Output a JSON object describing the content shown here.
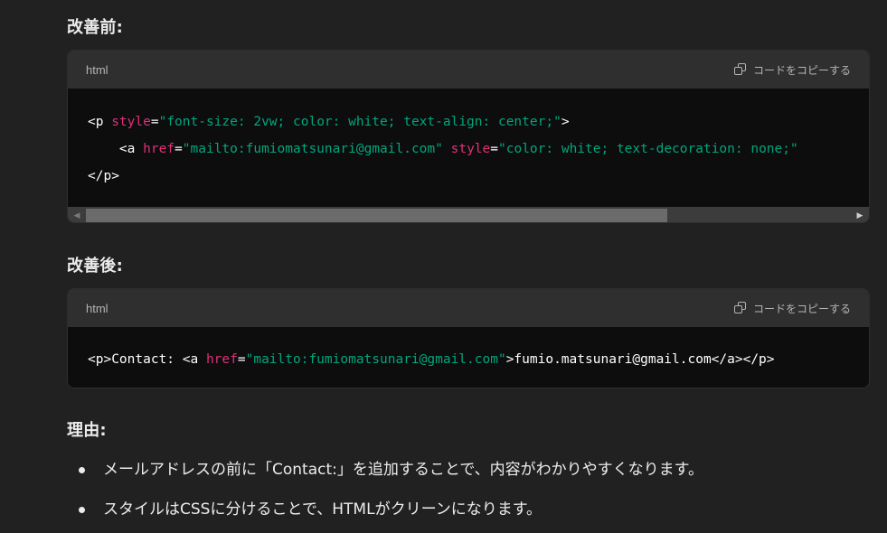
{
  "sections": {
    "before_heading": "改善前:",
    "after_heading": "改善後:",
    "reason_heading": "理由:"
  },
  "code_before": {
    "language": "html",
    "copy_label": "コードをコピーする",
    "line1": {
      "t1": "<p ",
      "a1": "style",
      "t2": "=",
      "s1": "\"font-size: 2vw; color: white; text-align: center;\"",
      "t3": ">"
    },
    "line2": {
      "indent": "    ",
      "t1": "<a ",
      "a1": "href",
      "t2": "=",
      "s1": "\"mailto:fumiomatsunari@gmail.com\"",
      "t3": " ",
      "a2": "style",
      "t4": "=",
      "s2": "\"color: white; text-decoration: none;\""
    },
    "line3": "</p>",
    "scroll_fraction": 0.76
  },
  "code_after": {
    "language": "html",
    "copy_label": "コードをコピーする",
    "line1": {
      "t1": "<p>Contact: <a ",
      "a1": "href",
      "t2": "=",
      "s1": "\"mailto:fumiomatsunari@gmail.com\"",
      "t3": ">fumio.matsunari@gmail.com</a></p>"
    }
  },
  "reasons": [
    "メールアドレスの前に「Contact:」を追加することで、内容がわかりやすくなります。",
    "スタイルはCSSに分けることで、HTMLがクリーンになります。"
  ],
  "colors": {
    "background": "#212121",
    "code_header": "#2f2f2f",
    "code_body": "#0d0d0d",
    "attr_pink": "#df3079",
    "string_green": "#00a67d"
  },
  "icons": {
    "copy": "copy-icon",
    "bullet": "bullet-dot"
  }
}
